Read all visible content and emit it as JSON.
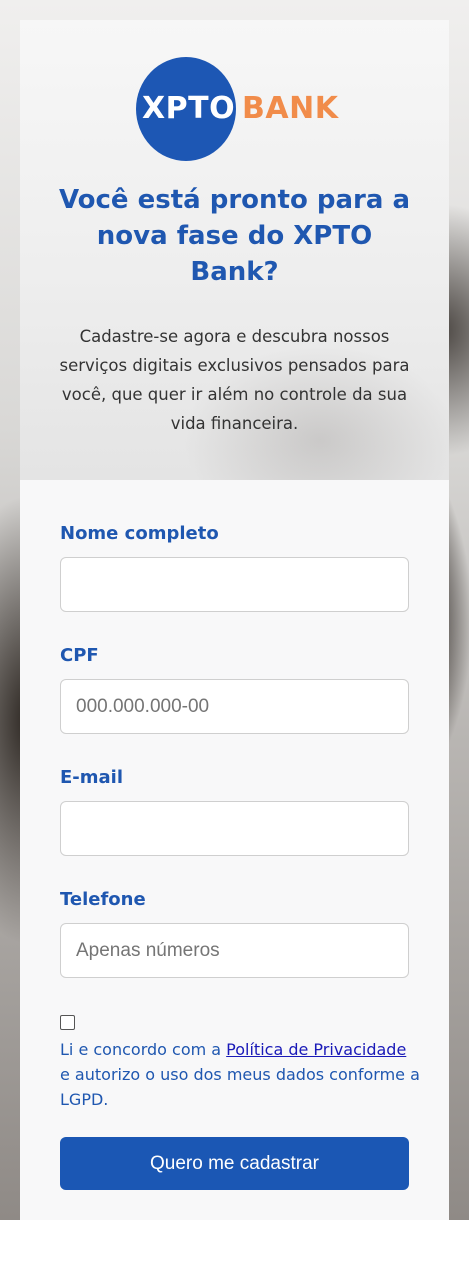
{
  "logo": {
    "part1": "XPTO",
    "part2": "BANK",
    "circle_color": "#1d57b4",
    "bank_color": "#f18c4a"
  },
  "hero": {
    "title": "Você está pronto para a nova fase do XPTO Bank?",
    "subtitle": "Cadastre-se agora e descubra nossos serviços digitais exclusivos pensados para você, que quer ir além no controle da sua vida financeira."
  },
  "form": {
    "name_label": "Nome completo",
    "name_value": "",
    "cpf_label": "CPF",
    "cpf_placeholder": "000.000.000-00",
    "email_label": "E-mail",
    "email_value": "",
    "phone_label": "Telefone",
    "phone_placeholder": "Apenas números",
    "consent_before": "Li e concordo com a ",
    "consent_link": "Política de Privacidade",
    "consent_after": " e autorizo o uso dos meus dados conforme a LGPD.",
    "consent_checked": false,
    "submit_label": "Quero me cadastrar"
  },
  "colors": {
    "primary": "#1f57b0",
    "button": "#1b57b4",
    "link": "#1a1ab8"
  }
}
